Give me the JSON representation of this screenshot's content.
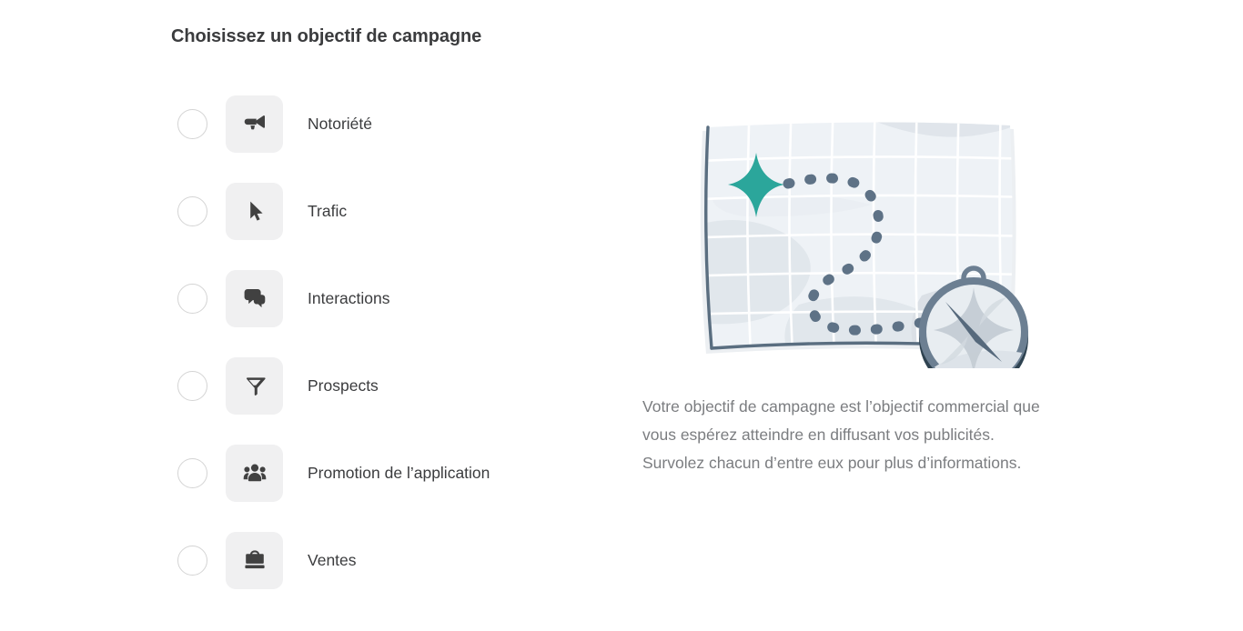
{
  "page": {
    "title": "Choisissez un objectif de campagne",
    "background": "#ffffff"
  },
  "colors": {
    "title_text": "#3b3c3e",
    "label_text": "#3b3c3e",
    "description_text": "#7b7d80",
    "icon_tile_background": "#f0f0f1",
    "icon_glyph": "#414141",
    "radio_border": "#d4d4d4",
    "accent_teal": "#2ba69b",
    "map_paper": "#eef2f5",
    "map_border": "#5a6e80",
    "map_grid": "#ffffff",
    "path_dash": "#5e7286",
    "compass_rim": "#6c7f92",
    "compass_shadow": "#2e4250",
    "compass_face": "#e8edf1"
  },
  "objectives": [
    {
      "id": "awareness",
      "label": "Notoriété",
      "icon": "megaphone-icon",
      "selected": false
    },
    {
      "id": "traffic",
      "label": "Trafic",
      "icon": "cursor-arrow-icon",
      "selected": false
    },
    {
      "id": "engagement",
      "label": "Interactions",
      "icon": "chat-bubbles-icon",
      "selected": false
    },
    {
      "id": "leads",
      "label": "Prospects",
      "icon": "funnel-icon",
      "selected": false
    },
    {
      "id": "app_promo",
      "label": "Promotion de l’application",
      "icon": "people-group-icon",
      "selected": false
    },
    {
      "id": "sales",
      "label": "Ventes",
      "icon": "briefcase-icon",
      "selected": false
    }
  ],
  "info_panel": {
    "illustration_name": "map-with-compass-illustration",
    "description": "Votre objectif de campagne est l’objectif commercial que vous espérez atteindre en diffusant vos publicités. Survolez chacun d’entre eux pour plus d’informations."
  }
}
